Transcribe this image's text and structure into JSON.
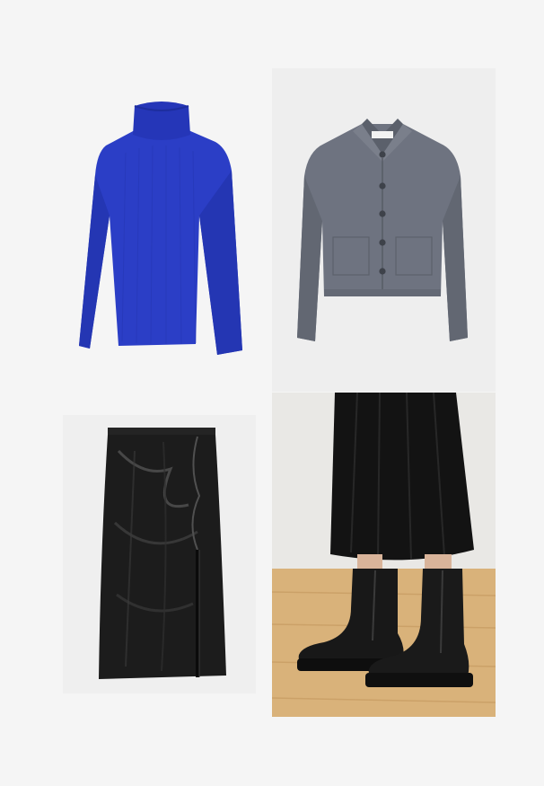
{
  "board": {
    "items": [
      {
        "kind": "turtleneck sweater",
        "color": "#2a3fc8"
      },
      {
        "kind": "buttoned jacket",
        "color": "#6b7079",
        "label_text": "Marc O'Polo"
      },
      {
        "kind": "faux leather midi skirt",
        "color": "#1b1b1b"
      },
      {
        "kind": "black ankle boots with midi skirt",
        "color": "#151515"
      }
    ]
  }
}
